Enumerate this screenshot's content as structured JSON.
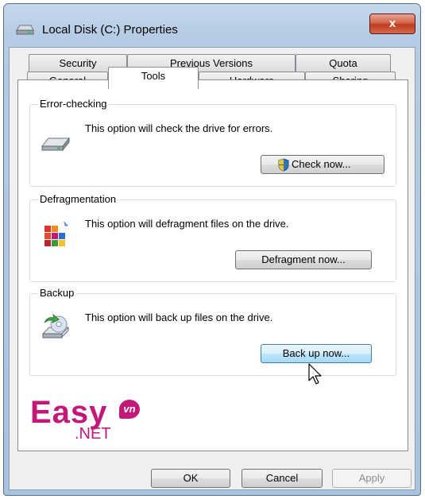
{
  "window": {
    "title": "Local Disk (C:) Properties",
    "close_label": "x"
  },
  "tabs": {
    "top_row": [
      "Security",
      "Previous Versions",
      "Quota"
    ],
    "bottom_row": [
      "General",
      "Tools",
      "Hardware",
      "Sharing"
    ],
    "active": "Tools"
  },
  "groups": {
    "error_checking": {
      "title": "Error-checking",
      "description": "This option will check the drive for errors.",
      "button": "Check now..."
    },
    "defragmentation": {
      "title": "Defragmentation",
      "description": "This option will defragment files on the drive.",
      "button": "Defragment now..."
    },
    "backup": {
      "title": "Backup",
      "description": "This option will back up files on the drive.",
      "button": "Back up now..."
    }
  },
  "footer": {
    "ok_label": "OK",
    "cancel_label": "Cancel",
    "apply_label": "Apply"
  },
  "watermark": {
    "text": "Easy",
    "suffix": "vn",
    "net": ".NET"
  },
  "icons": [
    "window-drive-icon",
    "close-icon",
    "drive-icon",
    "shield-icon",
    "defrag-icon",
    "backup-icon",
    "mouse-cursor-icon"
  ],
  "colors": {
    "accent": "#3c7fb1",
    "close": "#c13b1f",
    "watermark": "#c2187a"
  }
}
